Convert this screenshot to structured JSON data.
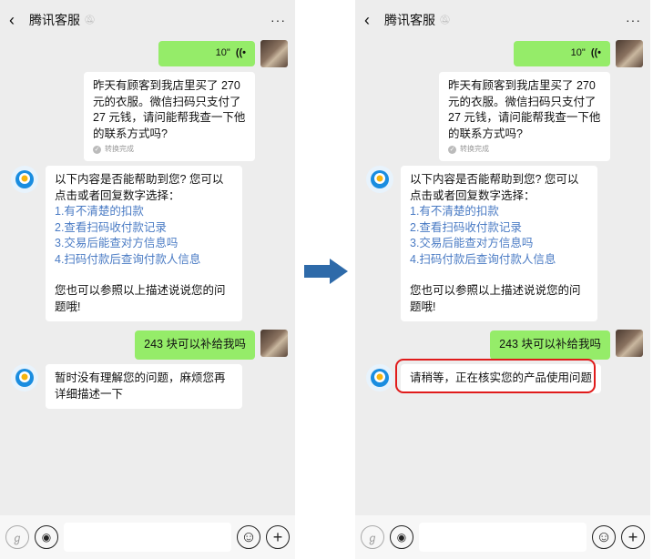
{
  "colors": {
    "arrow": "#2e6aa9",
    "highlight": "#e01b1b",
    "user_bubble": "#95ec69",
    "link": "#4a7bc4"
  },
  "nav": {
    "back_icon": "chevron-left-icon",
    "title": "腾讯客服",
    "mute_icon": "mute-icon",
    "more": "···"
  },
  "voice_msg": {
    "duration": "10\"",
    "icon": "voice-wave-icon",
    "wave": "((•"
  },
  "transcript": {
    "text": "昨天有顾客到我店里买了 270 元的衣服。微信扫码只支付了 27 元钱，请问能帮我查一下他的联系方式吗?",
    "status": "转换完成"
  },
  "bot_menu": {
    "intro": "以下内容是否能帮助到您? 您可以点击或者回复数字选择：",
    "options": [
      "1.有不清楚的扣款",
      "2.查看扫码收付款记录",
      "3.交易后能查对方信息吗",
      "4.扫码付款后查询付款人信息"
    ],
    "footer": "您也可以参照以上描述说说您的问题哦!"
  },
  "user_msg": "243 块可以补给我吗",
  "bot_reply_left": "暂时没有理解您的问题，麻烦您再详细描述一下",
  "bot_reply_right": "请稍等，正在核实您的产品使用问题",
  "inputbar": {
    "left_icon": "mini-program-icon",
    "voice_icon": "voice-input-icon",
    "emoji_icon": "emoji-icon",
    "plus_icon": "plus-icon"
  }
}
